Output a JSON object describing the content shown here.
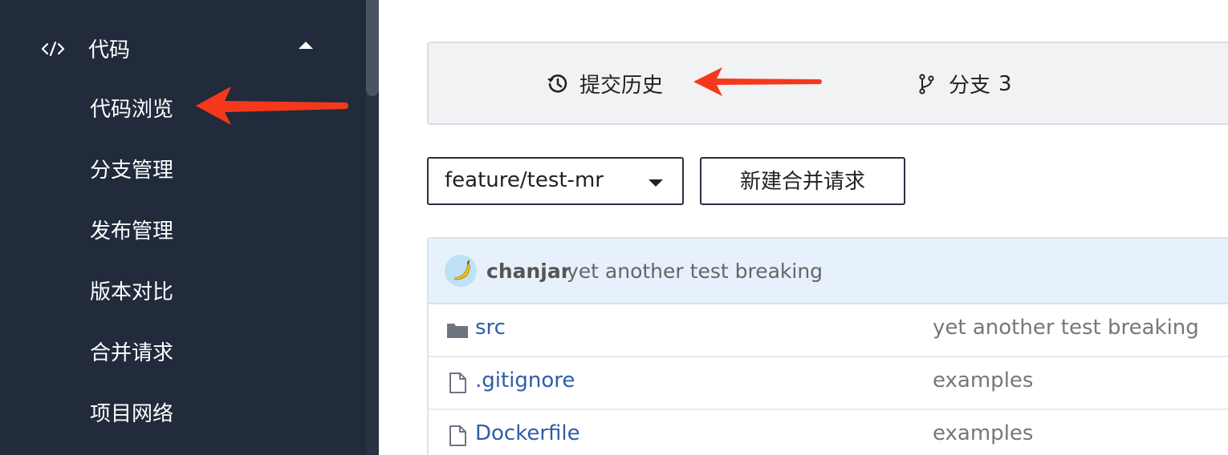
{
  "sidebar": {
    "group": {
      "label": "代码",
      "icon": "code-icon",
      "expanded": true
    },
    "items": [
      {
        "label": "代码浏览"
      },
      {
        "label": "分支管理"
      },
      {
        "label": "发布管理"
      },
      {
        "label": "版本对比"
      },
      {
        "label": "合并请求"
      },
      {
        "label": "项目网络"
      }
    ]
  },
  "tabs": {
    "history": {
      "label": "提交历史",
      "icon": "history-icon"
    },
    "branches": {
      "label": "分支",
      "count": "3",
      "icon": "git-branch-icon"
    }
  },
  "toolbar": {
    "branch_select_value": "feature/test-mr",
    "new_merge_request_label": "新建合并请求"
  },
  "latest_commit": {
    "author": "chanjar",
    "message": "yet another test breaking"
  },
  "files": [
    {
      "name": "src",
      "type": "folder",
      "icon": "folder-icon",
      "last_commit": "yet another test breaking"
    },
    {
      "name": ".gitignore",
      "type": "file",
      "icon": "file-icon",
      "last_commit": "examples"
    },
    {
      "name": "Dockerfile",
      "type": "file",
      "icon": "file-icon",
      "last_commit": "examples"
    }
  ],
  "colors": {
    "sidebar_bg": "#222b3c",
    "annotation_arrow": "#f5381c",
    "link": "#2f5da8",
    "commit_header_bg": "#e7f1fb"
  }
}
